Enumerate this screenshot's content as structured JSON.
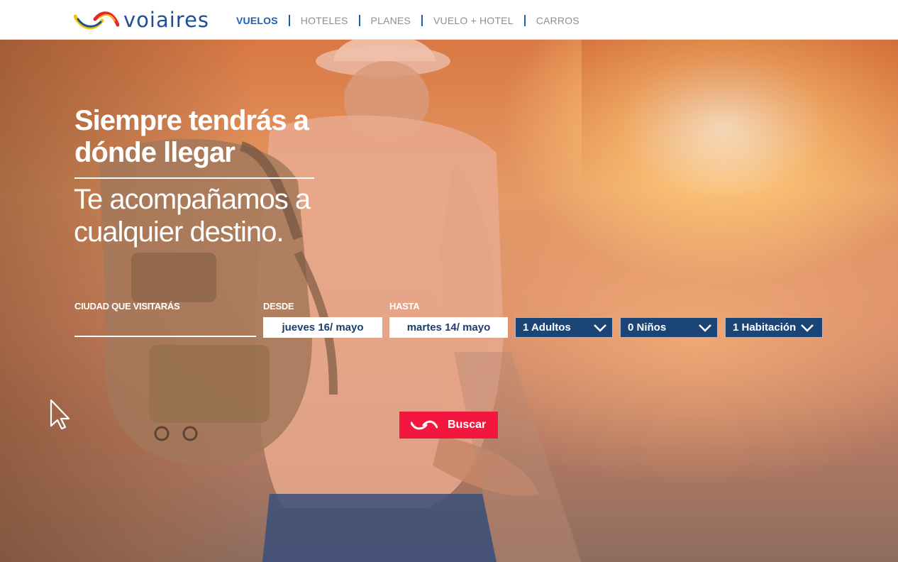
{
  "brand": {
    "name": "voiaires",
    "colors": {
      "primary_blue": "#1c5fb0",
      "dark_blue": "#1a4576",
      "accent_red": "#f3173f",
      "logo_yellow": "#f5c400",
      "logo_red": "#e8262c"
    }
  },
  "nav": {
    "items": [
      {
        "label": "VUELOS",
        "active": true
      },
      {
        "label": "HOTELES",
        "active": false
      },
      {
        "label": "PLANES",
        "active": false
      },
      {
        "label": "VUELO + HOTEL",
        "active": false
      },
      {
        "label": "CARROS",
        "active": false
      }
    ]
  },
  "hero": {
    "title": "Siempre tendrás a dónde llegar",
    "subtitle": "Te acompañamos a cualquier destino."
  },
  "search": {
    "city_label": "CIUDAD QUE VISITARÁS",
    "city_value": "",
    "from_label": "DESDE",
    "from_value": "jueves 16/ mayo",
    "to_label": "HASTA",
    "to_value": "martes 14/ mayo",
    "adults": "1 Adultos",
    "children": "0 Niños",
    "rooms": "1 Habitación",
    "submit_label": "Buscar"
  },
  "icons": {
    "logo": "voiaires-wave-logo",
    "dropdown": "chevron-down-icon",
    "button": "wave-icon",
    "cursor": "mouse-pointer-icon"
  }
}
